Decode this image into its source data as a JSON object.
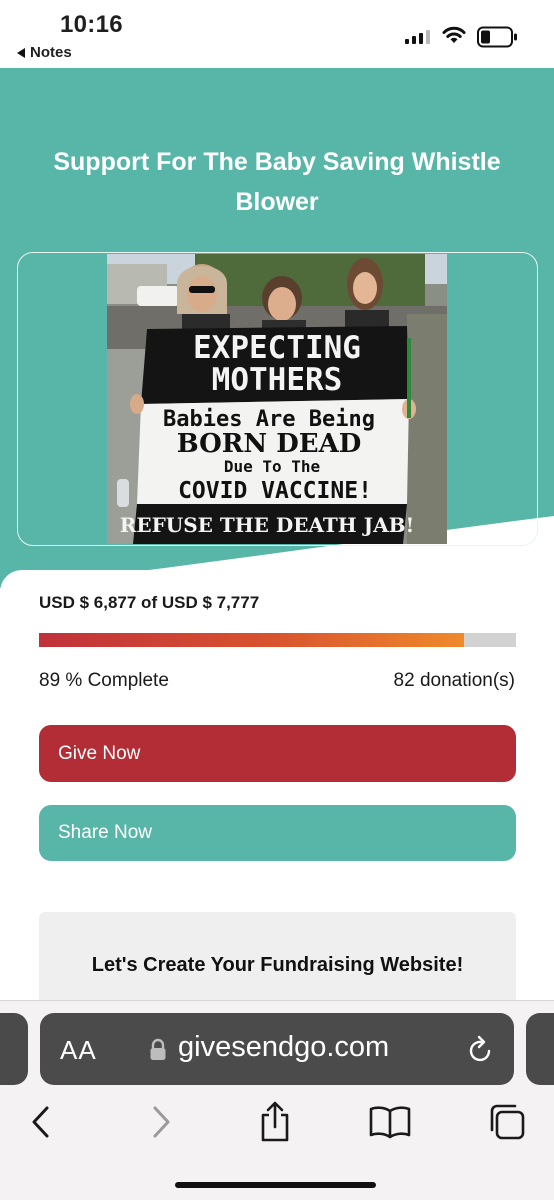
{
  "status_bar": {
    "time": "10:16",
    "back_app": "Notes"
  },
  "campaign": {
    "title": "Support For The Baby Saving Whistle Blower",
    "photo": {
      "banner_lines": [
        "EXPECTING",
        "MOTHERS",
        "Babies Are Being",
        "BORN DEAD",
        "Due To The",
        "COVID VACCINE!",
        "REFUSE THE DEATH JAB!"
      ]
    }
  },
  "progress": {
    "raised_text": "USD $ 6,877 of USD $ 7,777",
    "fraction_complete": 0.89,
    "percent_text": "89 % Complete",
    "donations_text": "82 donation(s)"
  },
  "actions": {
    "give_label": "Give Now",
    "share_label": "Share Now"
  },
  "promo": {
    "title": "Let's Create Your Fundraising Website!"
  },
  "safari": {
    "text_size_label": "AA",
    "url": "givesendgo.com",
    "icons": [
      "lock-icon",
      "reload-icon",
      "back-arrow-icon",
      "forward-arrow-icon",
      "share-icon",
      "bookmarks-icon",
      "tabs-icon"
    ]
  },
  "colors": {
    "teal": "#58b6a8",
    "give_red": "#b22d35",
    "progress_start": "#c0313a",
    "progress_end": "#ef8a2c",
    "track": "#d2d2d2"
  }
}
